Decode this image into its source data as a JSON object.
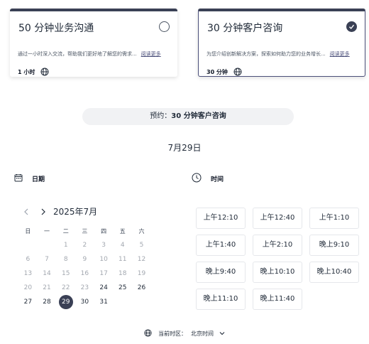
{
  "cards": [
    {
      "title": "50 分钟业务沟通",
      "desc": "通过一小时深入交流，帮助我们更好地了解您的需求...",
      "read_more": "阅读更多",
      "duration": "1 小时",
      "selected": false
    },
    {
      "title": "30 分钟客户咨询",
      "desc": "为您介绍创新解决方案，探索如何助力您的业务增长...",
      "read_more": "阅读更多",
      "duration": "30 分钟",
      "selected": true
    }
  ],
  "banner": {
    "prefix": "预约：",
    "service": "30 分钟客户咨询"
  },
  "selected_date": "7月29日",
  "date_section": {
    "label": "日期"
  },
  "time_section": {
    "label": "时间"
  },
  "calendar": {
    "month_label": "2025年7月",
    "weekdays": [
      "日",
      "一",
      "二",
      "三",
      "四",
      "五",
      "六"
    ],
    "weeks": [
      [
        "",
        "",
        "1",
        "2",
        "3",
        "4",
        "5"
      ],
      [
        "6",
        "7",
        "8",
        "9",
        "10",
        "11",
        "12"
      ],
      [
        "13",
        "14",
        "15",
        "16",
        "17",
        "18",
        "19"
      ],
      [
        "20",
        "21",
        "22",
        "23",
        "24",
        "25",
        "26"
      ],
      [
        "27",
        "28",
        "29",
        "30",
        "31",
        "",
        ""
      ]
    ],
    "first_available": 24,
    "selected_day": 29
  },
  "time_slots": [
    "上午12:10",
    "上午12:40",
    "上午1:10",
    "上午1:40",
    "上午2:10",
    "晚上9:10",
    "晚上9:40",
    "晚上10:10",
    "晚上10:40",
    "晚上11:10",
    "晚上11:40"
  ],
  "timezone": {
    "label": "当前时区：",
    "value": "北京时间"
  },
  "colors": {
    "accent": "#3a4055",
    "muted_day": "#a3a8b0",
    "banner_bg": "#f1f2f4"
  }
}
